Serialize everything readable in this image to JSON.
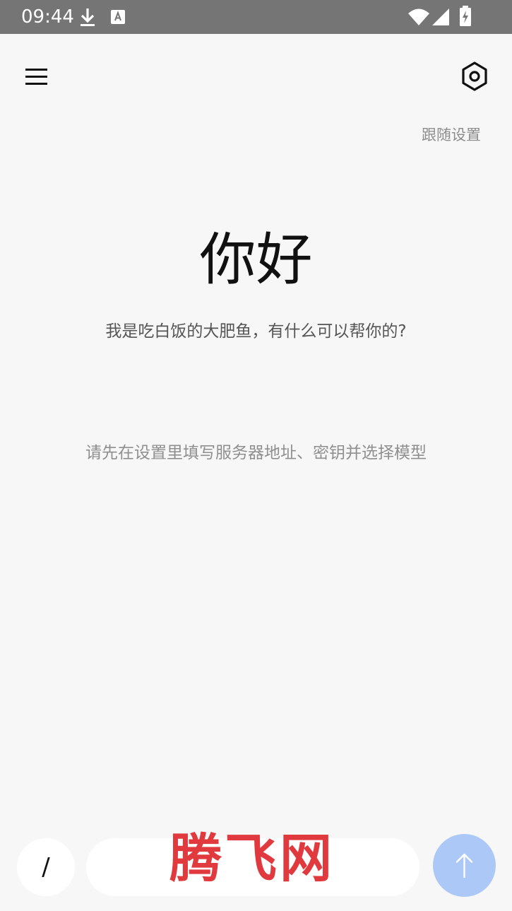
{
  "status_bar": {
    "time": "09:44",
    "icons": [
      "download-icon",
      "keyboard-a-icon",
      "wifi-icon",
      "signal-icon",
      "battery-charging-icon"
    ]
  },
  "header": {
    "menu_icon": "hamburger-menu-icon",
    "settings_icon": "hexagon-settings-icon"
  },
  "theme_toggle": {
    "label": "跟随设置"
  },
  "hero": {
    "title": "你好",
    "subtitle": "我是吃白饭的大肥鱼，有什么可以帮你的?"
  },
  "hint": {
    "text": "请先在设置里填写服务器地址、密钥并选择模型"
  },
  "composer": {
    "slash_label": "/",
    "input_value": "",
    "input_placeholder": "",
    "send_icon": "arrow-up-icon",
    "send_color": "#abc8f6"
  },
  "watermark": {
    "text": "腾飞网"
  }
}
